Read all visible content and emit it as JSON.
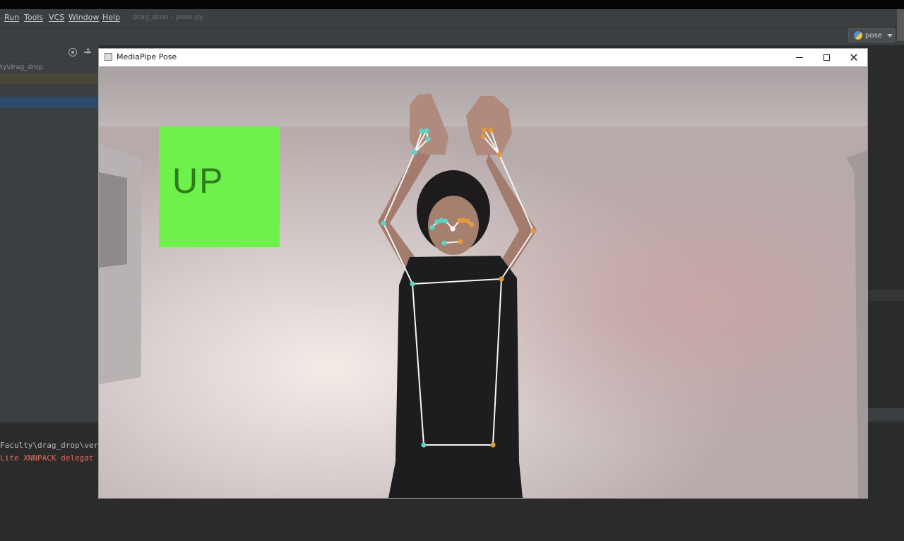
{
  "menubar": {
    "items": [
      {
        "id": "run",
        "label": "Run"
      },
      {
        "id": "tools",
        "label": "Tools"
      },
      {
        "id": "vcs",
        "label": "VCS"
      },
      {
        "id": "window",
        "label": "Window"
      },
      {
        "id": "help",
        "label": "Help"
      }
    ],
    "project_title": "drag_drop - pose.py"
  },
  "toolbar": {
    "run_config": {
      "label": "pose",
      "icon": "python-icon"
    }
  },
  "project_panel": {
    "path_label": "ty\\drag_drop",
    "icons": [
      "locate-icon",
      "collapse-all-icon"
    ]
  },
  "console": {
    "lines": [
      {
        "text": "Faculty\\drag_drop\\ver",
        "color": "#bbbbbb"
      },
      {
        "text": " Lite XNNPACK delegat",
        "color": "#e06c60"
      }
    ]
  },
  "window": {
    "title": "MediaPipe Pose",
    "buttons": [
      {
        "id": "minimize",
        "icon": "minimize-icon"
      },
      {
        "id": "maximize",
        "icon": "maximize-icon"
      },
      {
        "id": "close",
        "icon": "close-icon",
        "glyph": "✕"
      }
    ]
  },
  "overlay": {
    "label": "UP",
    "box_color": "#6ef14a",
    "text_color": "#2f7c1c"
  },
  "pose": {
    "connection_color": "#f5f5f5",
    "left_color": "#5fd3c8",
    "right_color": "#e39a3c"
  }
}
